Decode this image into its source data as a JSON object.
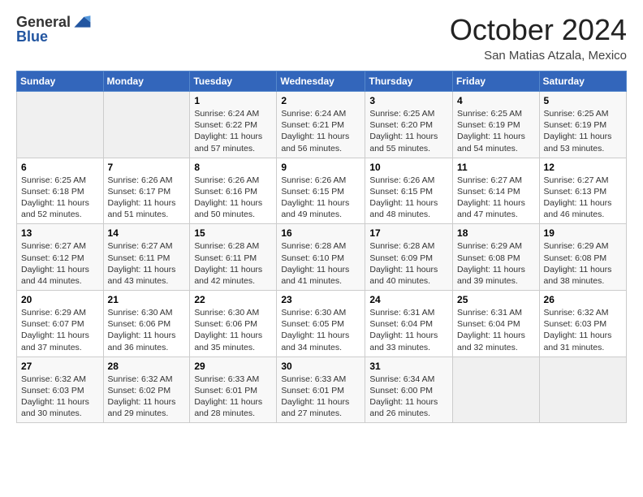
{
  "logo": {
    "general": "General",
    "blue": "Blue"
  },
  "header": {
    "month": "October 2024",
    "location": "San Matias Atzala, Mexico"
  },
  "weekdays": [
    "Sunday",
    "Monday",
    "Tuesday",
    "Wednesday",
    "Thursday",
    "Friday",
    "Saturday"
  ],
  "weeks": [
    [
      {
        "day": "",
        "info": ""
      },
      {
        "day": "",
        "info": ""
      },
      {
        "day": "1",
        "info": "Sunrise: 6:24 AM\nSunset: 6:22 PM\nDaylight: 11 hours and 57 minutes."
      },
      {
        "day": "2",
        "info": "Sunrise: 6:24 AM\nSunset: 6:21 PM\nDaylight: 11 hours and 56 minutes."
      },
      {
        "day": "3",
        "info": "Sunrise: 6:25 AM\nSunset: 6:20 PM\nDaylight: 11 hours and 55 minutes."
      },
      {
        "day": "4",
        "info": "Sunrise: 6:25 AM\nSunset: 6:19 PM\nDaylight: 11 hours and 54 minutes."
      },
      {
        "day": "5",
        "info": "Sunrise: 6:25 AM\nSunset: 6:19 PM\nDaylight: 11 hours and 53 minutes."
      }
    ],
    [
      {
        "day": "6",
        "info": "Sunrise: 6:25 AM\nSunset: 6:18 PM\nDaylight: 11 hours and 52 minutes."
      },
      {
        "day": "7",
        "info": "Sunrise: 6:26 AM\nSunset: 6:17 PM\nDaylight: 11 hours and 51 minutes."
      },
      {
        "day": "8",
        "info": "Sunrise: 6:26 AM\nSunset: 6:16 PM\nDaylight: 11 hours and 50 minutes."
      },
      {
        "day": "9",
        "info": "Sunrise: 6:26 AM\nSunset: 6:15 PM\nDaylight: 11 hours and 49 minutes."
      },
      {
        "day": "10",
        "info": "Sunrise: 6:26 AM\nSunset: 6:15 PM\nDaylight: 11 hours and 48 minutes."
      },
      {
        "day": "11",
        "info": "Sunrise: 6:27 AM\nSunset: 6:14 PM\nDaylight: 11 hours and 47 minutes."
      },
      {
        "day": "12",
        "info": "Sunrise: 6:27 AM\nSunset: 6:13 PM\nDaylight: 11 hours and 46 minutes."
      }
    ],
    [
      {
        "day": "13",
        "info": "Sunrise: 6:27 AM\nSunset: 6:12 PM\nDaylight: 11 hours and 44 minutes."
      },
      {
        "day": "14",
        "info": "Sunrise: 6:27 AM\nSunset: 6:11 PM\nDaylight: 11 hours and 43 minutes."
      },
      {
        "day": "15",
        "info": "Sunrise: 6:28 AM\nSunset: 6:11 PM\nDaylight: 11 hours and 42 minutes."
      },
      {
        "day": "16",
        "info": "Sunrise: 6:28 AM\nSunset: 6:10 PM\nDaylight: 11 hours and 41 minutes."
      },
      {
        "day": "17",
        "info": "Sunrise: 6:28 AM\nSunset: 6:09 PM\nDaylight: 11 hours and 40 minutes."
      },
      {
        "day": "18",
        "info": "Sunrise: 6:29 AM\nSunset: 6:08 PM\nDaylight: 11 hours and 39 minutes."
      },
      {
        "day": "19",
        "info": "Sunrise: 6:29 AM\nSunset: 6:08 PM\nDaylight: 11 hours and 38 minutes."
      }
    ],
    [
      {
        "day": "20",
        "info": "Sunrise: 6:29 AM\nSunset: 6:07 PM\nDaylight: 11 hours and 37 minutes."
      },
      {
        "day": "21",
        "info": "Sunrise: 6:30 AM\nSunset: 6:06 PM\nDaylight: 11 hours and 36 minutes."
      },
      {
        "day": "22",
        "info": "Sunrise: 6:30 AM\nSunset: 6:06 PM\nDaylight: 11 hours and 35 minutes."
      },
      {
        "day": "23",
        "info": "Sunrise: 6:30 AM\nSunset: 6:05 PM\nDaylight: 11 hours and 34 minutes."
      },
      {
        "day": "24",
        "info": "Sunrise: 6:31 AM\nSunset: 6:04 PM\nDaylight: 11 hours and 33 minutes."
      },
      {
        "day": "25",
        "info": "Sunrise: 6:31 AM\nSunset: 6:04 PM\nDaylight: 11 hours and 32 minutes."
      },
      {
        "day": "26",
        "info": "Sunrise: 6:32 AM\nSunset: 6:03 PM\nDaylight: 11 hours and 31 minutes."
      }
    ],
    [
      {
        "day": "27",
        "info": "Sunrise: 6:32 AM\nSunset: 6:03 PM\nDaylight: 11 hours and 30 minutes."
      },
      {
        "day": "28",
        "info": "Sunrise: 6:32 AM\nSunset: 6:02 PM\nDaylight: 11 hours and 29 minutes."
      },
      {
        "day": "29",
        "info": "Sunrise: 6:33 AM\nSunset: 6:01 PM\nDaylight: 11 hours and 28 minutes."
      },
      {
        "day": "30",
        "info": "Sunrise: 6:33 AM\nSunset: 6:01 PM\nDaylight: 11 hours and 27 minutes."
      },
      {
        "day": "31",
        "info": "Sunrise: 6:34 AM\nSunset: 6:00 PM\nDaylight: 11 hours and 26 minutes."
      },
      {
        "day": "",
        "info": ""
      },
      {
        "day": "",
        "info": ""
      }
    ]
  ]
}
